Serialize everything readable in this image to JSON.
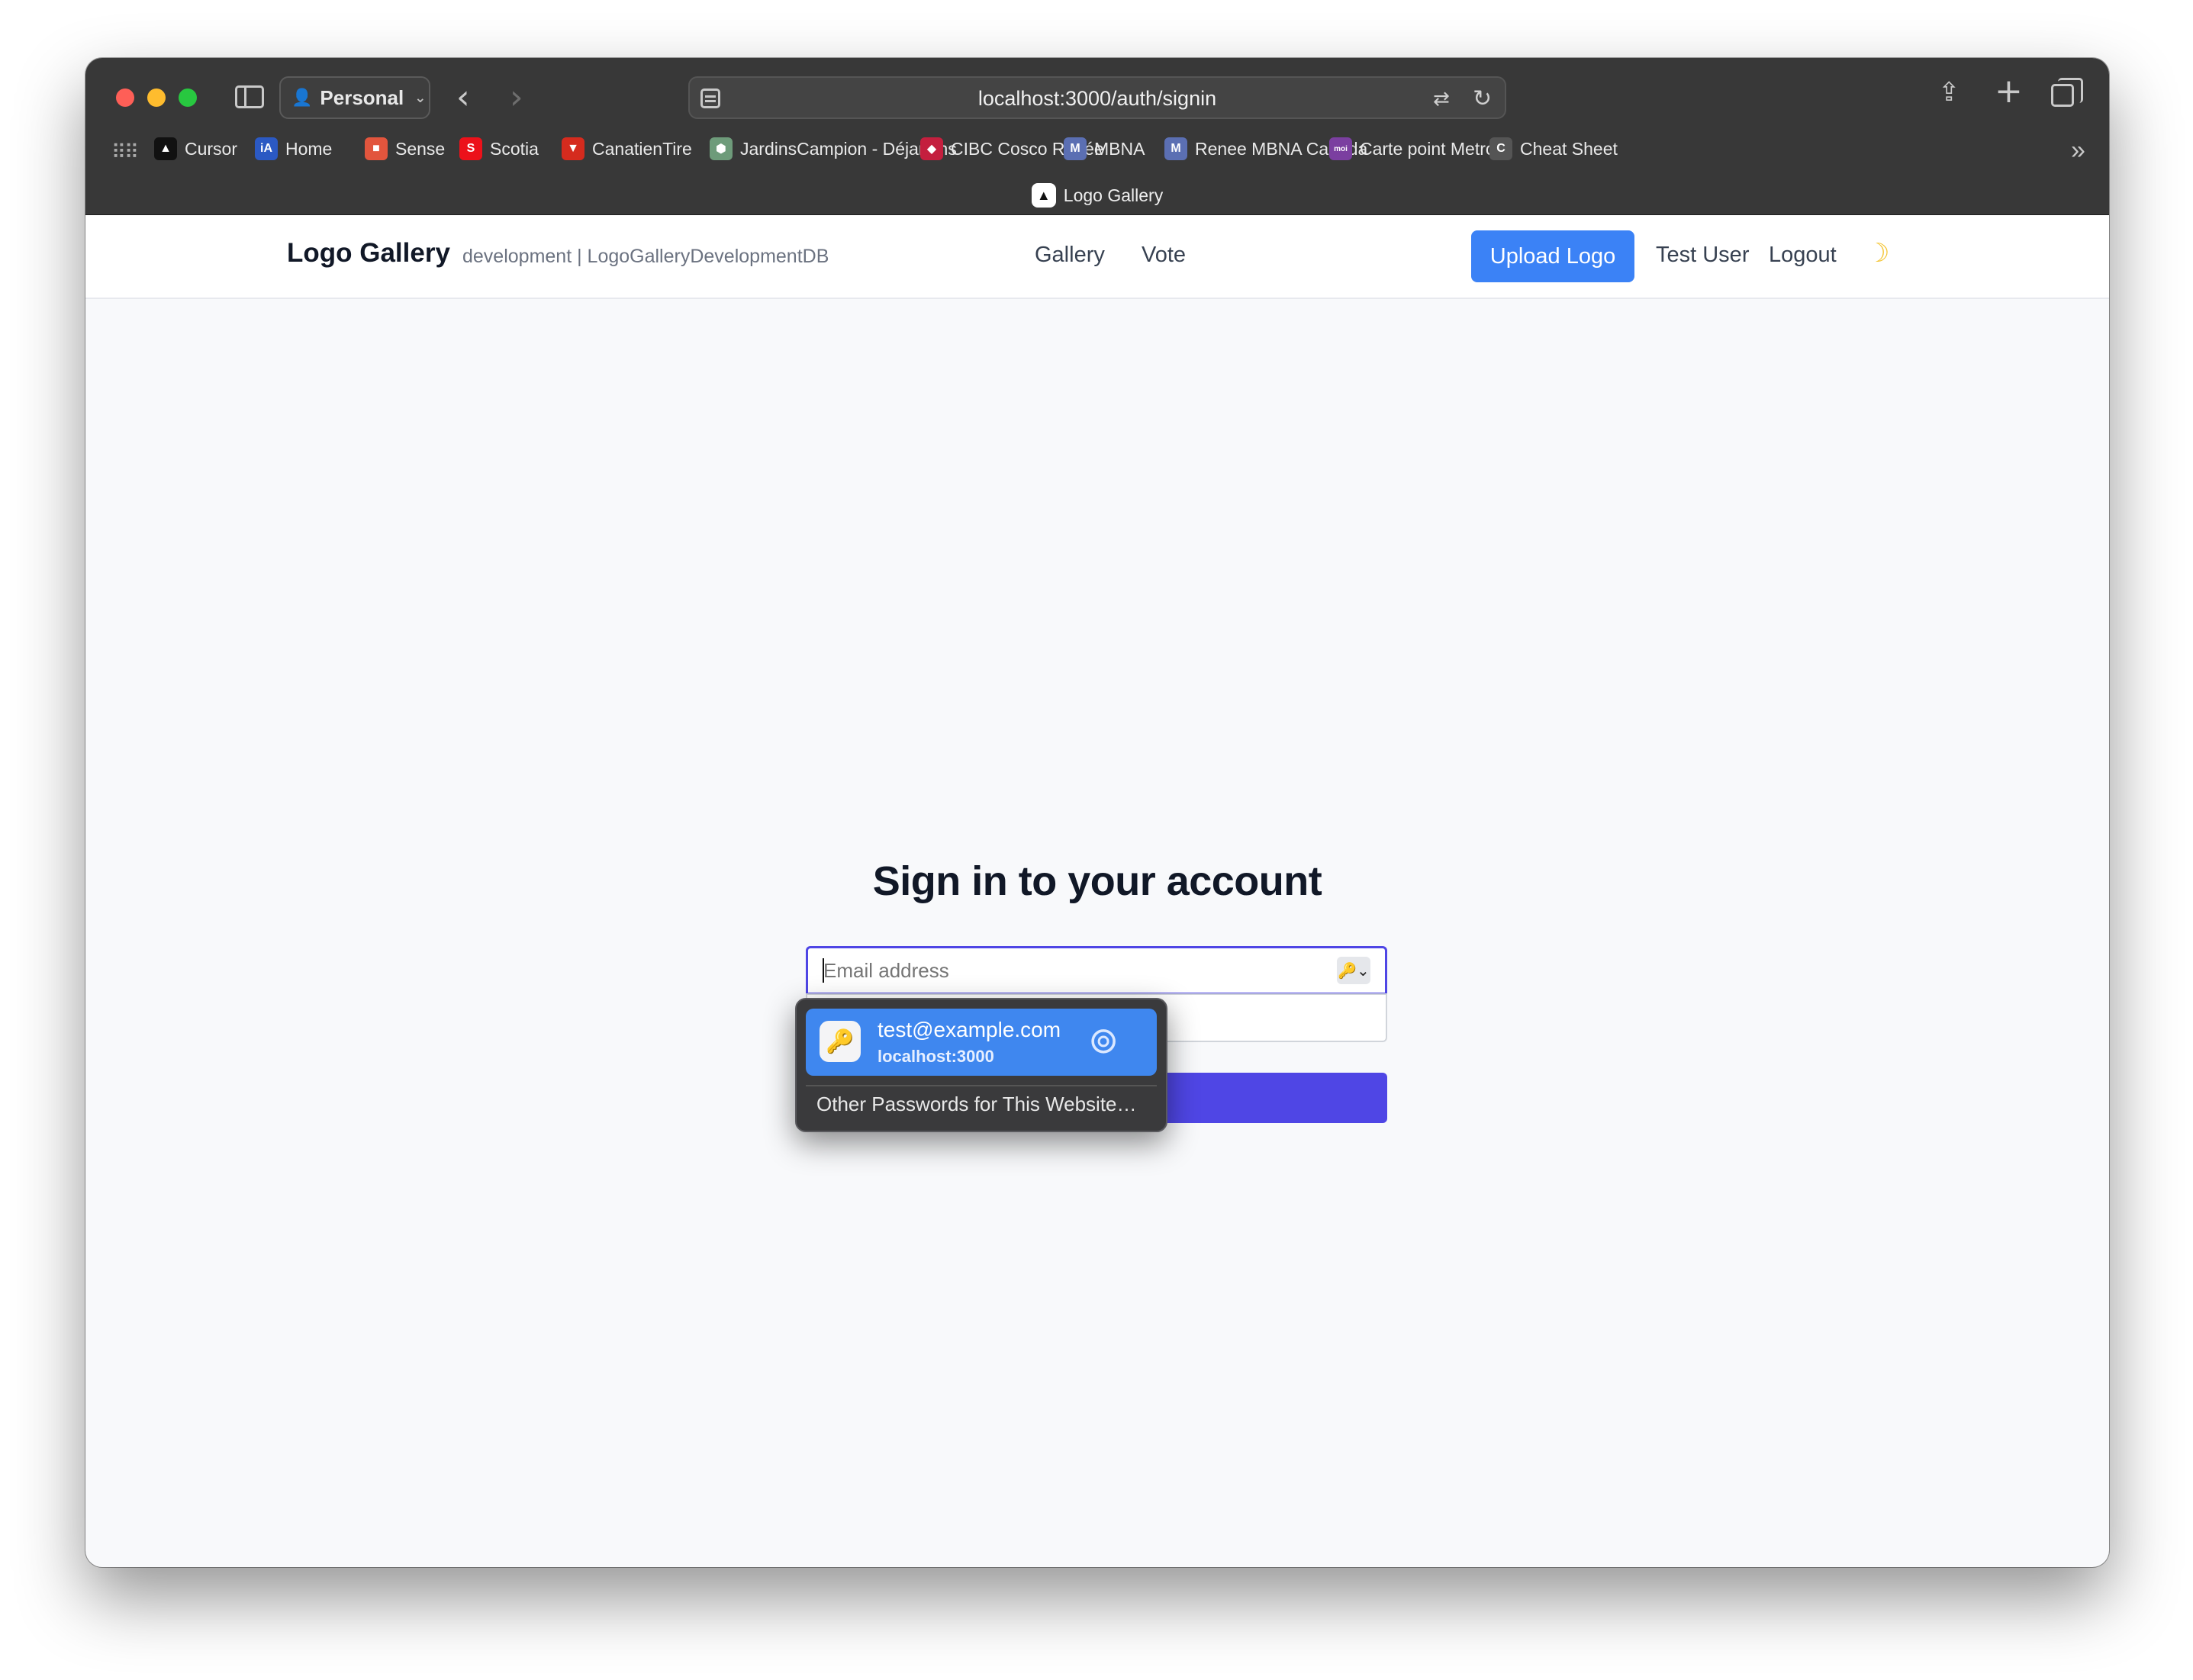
{
  "browser": {
    "profile": "Personal",
    "url": "localhost:3000/auth/signin",
    "bookmarks": [
      {
        "label": "Cursor",
        "icon": "cursor-logo-icon",
        "color": "#111111",
        "glyph": "▲"
      },
      {
        "label": "Home",
        "icon": "ia-logo-icon",
        "color": "#2b59c3",
        "glyph": "iA"
      },
      {
        "label": "Sense",
        "icon": "sense-logo-icon",
        "color": "#e2553d",
        "glyph": "■"
      },
      {
        "label": "Scotia",
        "icon": "scotia-logo-icon",
        "color": "#ec111a",
        "glyph": "S"
      },
      {
        "label": "CanatienTire",
        "icon": "canadian-tire-logo-icon",
        "color": "#d52b1e",
        "glyph": "▼"
      },
      {
        "label": "JardinsCampion - Déjardins",
        "icon": "desjardins-logo-icon",
        "color": "#6e9b7a",
        "glyph": "⬢"
      },
      {
        "label": "CIBC Cosco Renée",
        "icon": "cibc-logo-icon",
        "color": "#c41f3e",
        "glyph": "◆"
      },
      {
        "label": "MBNA",
        "icon": "mbna-logo-icon",
        "color": "#5b6fb3",
        "glyph": "M"
      },
      {
        "label": "Renee MBNA Canada",
        "icon": "mbna-logo-icon",
        "color": "#5b6fb3",
        "glyph": "M"
      },
      {
        "label": "Carte point Metro",
        "icon": "moi-logo-icon",
        "color": "#7b3fa0",
        "glyph": "moi"
      },
      {
        "label": "Cheat Sheet",
        "icon": "cheat-sheet-logo-icon",
        "color": "#555555",
        "glyph": "C"
      }
    ],
    "active_tab": "Logo Gallery"
  },
  "header": {
    "brand": "Logo Gallery",
    "env": "development | LogoGalleryDevelopmentDB",
    "nav": [
      "Gallery",
      "Vote"
    ],
    "upload_label": "Upload Logo",
    "user": "Test User",
    "logout": "Logout",
    "accent": "#3b82f6"
  },
  "signin": {
    "title": "Sign in to your account",
    "email_placeholder": "Email address",
    "primary_color": "#4f46e5"
  },
  "autofill": {
    "email": "test@example.com",
    "host": "localhost:3000",
    "other": "Other Passwords for This Website…"
  }
}
